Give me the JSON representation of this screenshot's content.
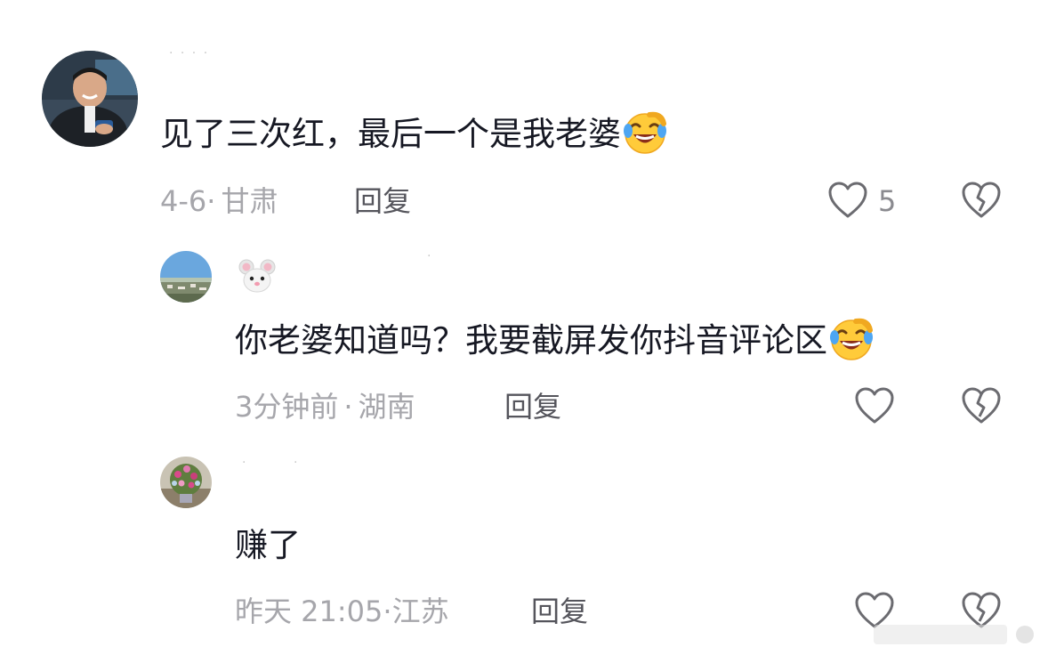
{
  "comments": [
    {
      "text": "见了三次红，最后一个是我老婆",
      "emoji": "face-with-tears-of-joy-icon",
      "date": "4-6",
      "location": "甘肃",
      "meta_sep": "·",
      "reply_label": "回复",
      "likes": "5"
    },
    {
      "badge": "mouse-face-icon",
      "text": "你老婆知道吗？我要截屏发你抖音评论区",
      "emoji": "face-with-tears-of-joy-icon",
      "date": "3分钟前",
      "location": "湖南",
      "meta_sep": "·",
      "reply_label": "回复",
      "likes": ""
    },
    {
      "text": "赚了",
      "date": "昨天 21:05",
      "location": "江苏",
      "meta_sep": "·",
      "reply_label": "回复",
      "likes": ""
    }
  ],
  "colors": {
    "text": "#161823",
    "meta": "#a6a6ab",
    "reply": "#55555c",
    "icon": "#6b6b70"
  }
}
